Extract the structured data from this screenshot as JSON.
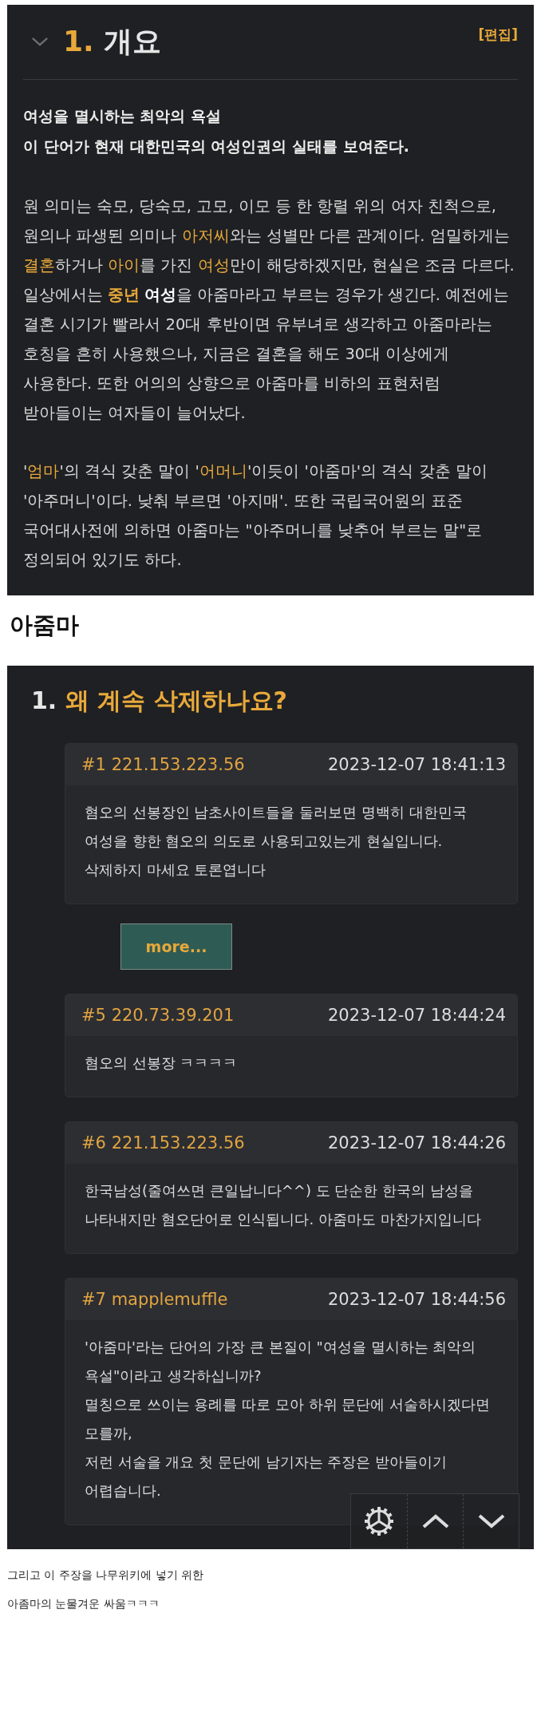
{
  "article": {
    "number": "1.",
    "title": "개요",
    "edit_link": "[편집]",
    "lead": [
      "여성을 멸시하는 최악의 욕설",
      "이 단어가 현재 대한민국의 여성인권의 실태를 보여준다."
    ],
    "paragraphs": [
      [
        {
          "kind": "plain",
          "text": "원 의미는 숙모, 당숙모, 고모, 이모 등 한 항렬 위의 여자 친척으로, 원의나 파생된 의미나 "
        },
        {
          "kind": "link",
          "text": "아저씨"
        },
        {
          "kind": "plain",
          "text": "와는 성별만 다른 관계이다. 엄밀하게는 "
        },
        {
          "kind": "link",
          "text": "결혼"
        },
        {
          "kind": "plain",
          "text": "하거나 "
        },
        {
          "kind": "link",
          "text": "아이"
        },
        {
          "kind": "plain",
          "text": "를 가진 "
        },
        {
          "kind": "link",
          "text": "여성"
        },
        {
          "kind": "plain",
          "text": "만이 해당하겠지만, 현실은 조금 다르다. 일상에서는 "
        },
        {
          "kind": "strong_link",
          "text": "중년"
        },
        {
          "kind": "strong",
          "text": "여성"
        },
        {
          "kind": "plain",
          "text": "을 아줌마라고 부르는 경우가 생긴다. 예전에는 결혼 시기가 빨라서 20대 후반이면 유부녀로 생각하고 아줌마라는 호칭을 흔히 사용했으나, 지금은 결혼을 해도 30대 이상에게 사용한다. 또한 어의의 상향으로 아줌마를 비하의 표현처럼 받아들이는 여자들이 늘어났다."
        }
      ],
      [
        {
          "kind": "plain",
          "text": "'"
        },
        {
          "kind": "link",
          "text": "엄마"
        },
        {
          "kind": "plain",
          "text": "'의 격식 갖춘 말이 '"
        },
        {
          "kind": "link",
          "text": "어머니"
        },
        {
          "kind": "plain",
          "text": "'이듯이 '아줌마'의 격식 갖춘 말이 '아주머니'이다. 낮춰 부르면 '아지매'. 또한 국립국어원의 표준 국어대사전에 의하면 아줌마는 \"아주머니를 낮추어 부르는 말\"로 정의되어 있기도 하다."
        }
      ]
    ]
  },
  "page_heading": "아줌마",
  "discussion": {
    "number": "1.",
    "title": "왜 계속 삭제하나요?",
    "more_button": "more...",
    "comments": [
      {
        "author": "#1 221.153.223.56",
        "time": "2023-12-07 18:41:13",
        "lines": [
          "혐오의 선봉장인 남초사이트들을 둘러보면 명백히 대한민국 여성을 향한 혐오의 의도로 사용되고있는게 현실입니다. 삭제하지 마세요 토론엽니다"
        ]
      },
      {
        "author": "#5 220.73.39.201",
        "time": "2023-12-07 18:44:24",
        "lines": [
          "혐오의 선봉장 ㅋㅋㅋㅋ"
        ]
      },
      {
        "author": "#6 221.153.223.56",
        "time": "2023-12-07 18:44:26",
        "lines": [
          "한국남성(줄여쓰면 큰일납니다^^) 도 단순한 한국의 남성을 나타내지만 혐오단어로 인식됩니다. 아줌마도 마찬가지입니다"
        ]
      },
      {
        "author": "#7 mapplemuffle",
        "time": "2023-12-07 18:44:56",
        "lines": [
          "'아줌마'라는 단어의 가장 큰 본질이 \"여성을 멸시하는 최악의 욕설\"이라고 생각하십니까?",
          "멸칭으로 쓰이는 용례를 따로 모아 하위 문단에 서술하시겠다면 모를까,",
          "저런 서술을 개요 첫 문단에 남기자는 주장은 받아들이기 어렵습니다."
        ]
      }
    ]
  },
  "caption": [
    "그리고 이 주장을 나무위키에 넣기 위한",
    "아좀마의 눈물겨운 싸움ㅋㅋㅋ"
  ]
}
